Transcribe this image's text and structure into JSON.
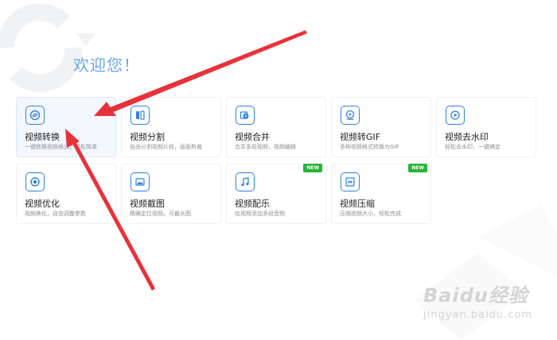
{
  "welcome": "欢迎您！",
  "cards": [
    {
      "title": "视频转换",
      "desc": "一键转换视频格式，轻松简单",
      "icon": "convert-icon",
      "selected": true,
      "badge": ""
    },
    {
      "title": "视频分割",
      "desc": "自由分割视频片段，画面剪裁",
      "icon": "split-icon",
      "selected": false,
      "badge": ""
    },
    {
      "title": "视频合并",
      "desc": "合并多段视频，视频编辑",
      "icon": "merge-icon",
      "selected": false,
      "badge": ""
    },
    {
      "title": "视频转GIF",
      "desc": "多种视频格式转换为GIF",
      "icon": "gif-icon",
      "selected": false,
      "badge": ""
    },
    {
      "title": "视频去水印",
      "desc": "轻松去水印，一键搞定",
      "icon": "watermark-icon",
      "selected": false,
      "badge": ""
    },
    {
      "title": "视频优化",
      "desc": "视频美化，自由调整参数",
      "icon": "optimize-icon",
      "selected": false,
      "badge": ""
    },
    {
      "title": "视频截图",
      "desc": "精确定位视频，可截长图",
      "icon": "screenshot-icon",
      "selected": false,
      "badge": ""
    },
    {
      "title": "视频配乐",
      "desc": "给视频添加多段音频",
      "icon": "music-icon",
      "selected": false,
      "badge": "NEW"
    },
    {
      "title": "视频压缩",
      "desc": "压缩视频大小，轻松完成",
      "icon": "compress-icon",
      "selected": false,
      "badge": "NEW"
    }
  ],
  "watermark": {
    "brand": "Baidu经验",
    "url": "jingyan.baidu.com"
  },
  "colors": {
    "accent": "#2f7fe6",
    "arrow": "#e8323a",
    "badge": "#27b43a",
    "welcome": "#6aa6e8"
  }
}
